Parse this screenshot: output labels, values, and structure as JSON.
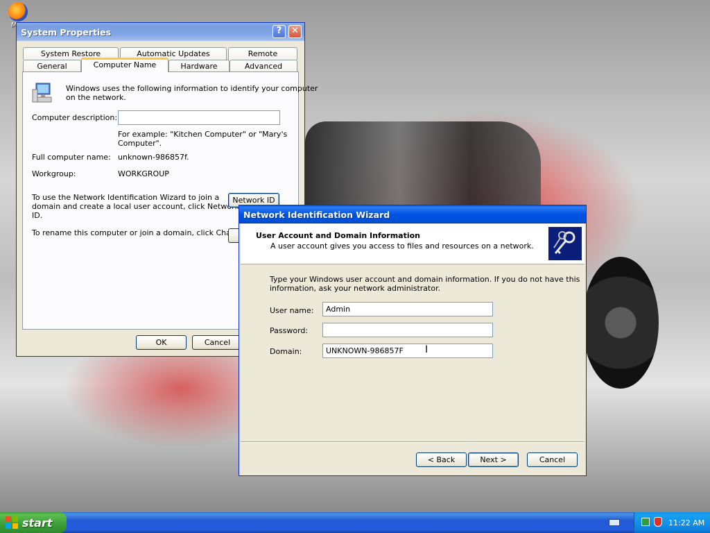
{
  "desktop": {
    "icons": [
      {
        "label": "Moz",
        "icon": "firefox-icon"
      }
    ]
  },
  "system_properties": {
    "title": "System Properties",
    "tabs_row1": [
      "System Restore",
      "Automatic Updates",
      "Remote"
    ],
    "tabs_row2": [
      "General",
      "Computer Name",
      "Hardware",
      "Advanced"
    ],
    "selected_tab": "Computer Name",
    "intro_line1": "Windows uses the following information to identify your computer",
    "intro_line2": "on the network.",
    "computer_description_label": "Computer description:",
    "computer_description_value": "",
    "example_line1": "For example: \"Kitchen Computer\" or \"Mary's",
    "example_line2": "Computer\".",
    "full_name_label": "Full computer name:",
    "full_name_value": "unknown-986857f.",
    "workgroup_label": "Workgroup:",
    "workgroup_value": "WORKGROUP",
    "network_id_text_line1": "To use the Network Identification Wizard to join a",
    "network_id_text_line2": "domain and create a local user account, click Network",
    "network_id_text_line3": "ID.",
    "network_id_button": "Network ID",
    "rename_text": "To rename this computer or join a domain, click Change.",
    "change_button": "C",
    "ok_button": "OK",
    "cancel_button": "Cancel"
  },
  "wizard": {
    "title": "Network Identification Wizard",
    "header_title": "User Account and Domain Information",
    "header_subtitle": "A user account gives you access to files and resources on a network.",
    "instructions_line1": "Type your Windows user account and domain information. If you do not have this",
    "instructions_line2": "information, ask your network administrator.",
    "username_label": "User name:",
    "username_value": "Admin",
    "password_label": "Password:",
    "password_value": "",
    "domain_label": "Domain:",
    "domain_value": "UNKNOWN-986857F",
    "back_button": "< Back",
    "next_button": "Next >",
    "cancel_button": "Cancel"
  },
  "taskbar": {
    "start_label": "start",
    "clock": "11:22 AM"
  }
}
